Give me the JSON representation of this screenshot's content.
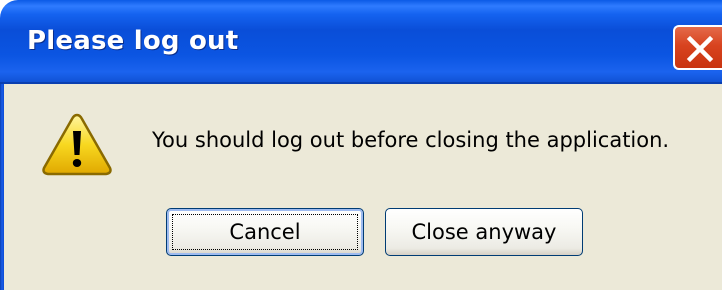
{
  "dialog": {
    "title": "Please log out",
    "message": "You should log out before closing the application.",
    "icon": "warning-icon",
    "buttons": {
      "cancel_label": "Cancel",
      "close_anyway_label": "Close anyway"
    },
    "focused_button": "Cancel"
  },
  "colors": {
    "titlebar": "#0b55e2",
    "client_background": "#ece9d8",
    "close_button": "#d8431f",
    "warning_yellow": "#f8d820"
  }
}
